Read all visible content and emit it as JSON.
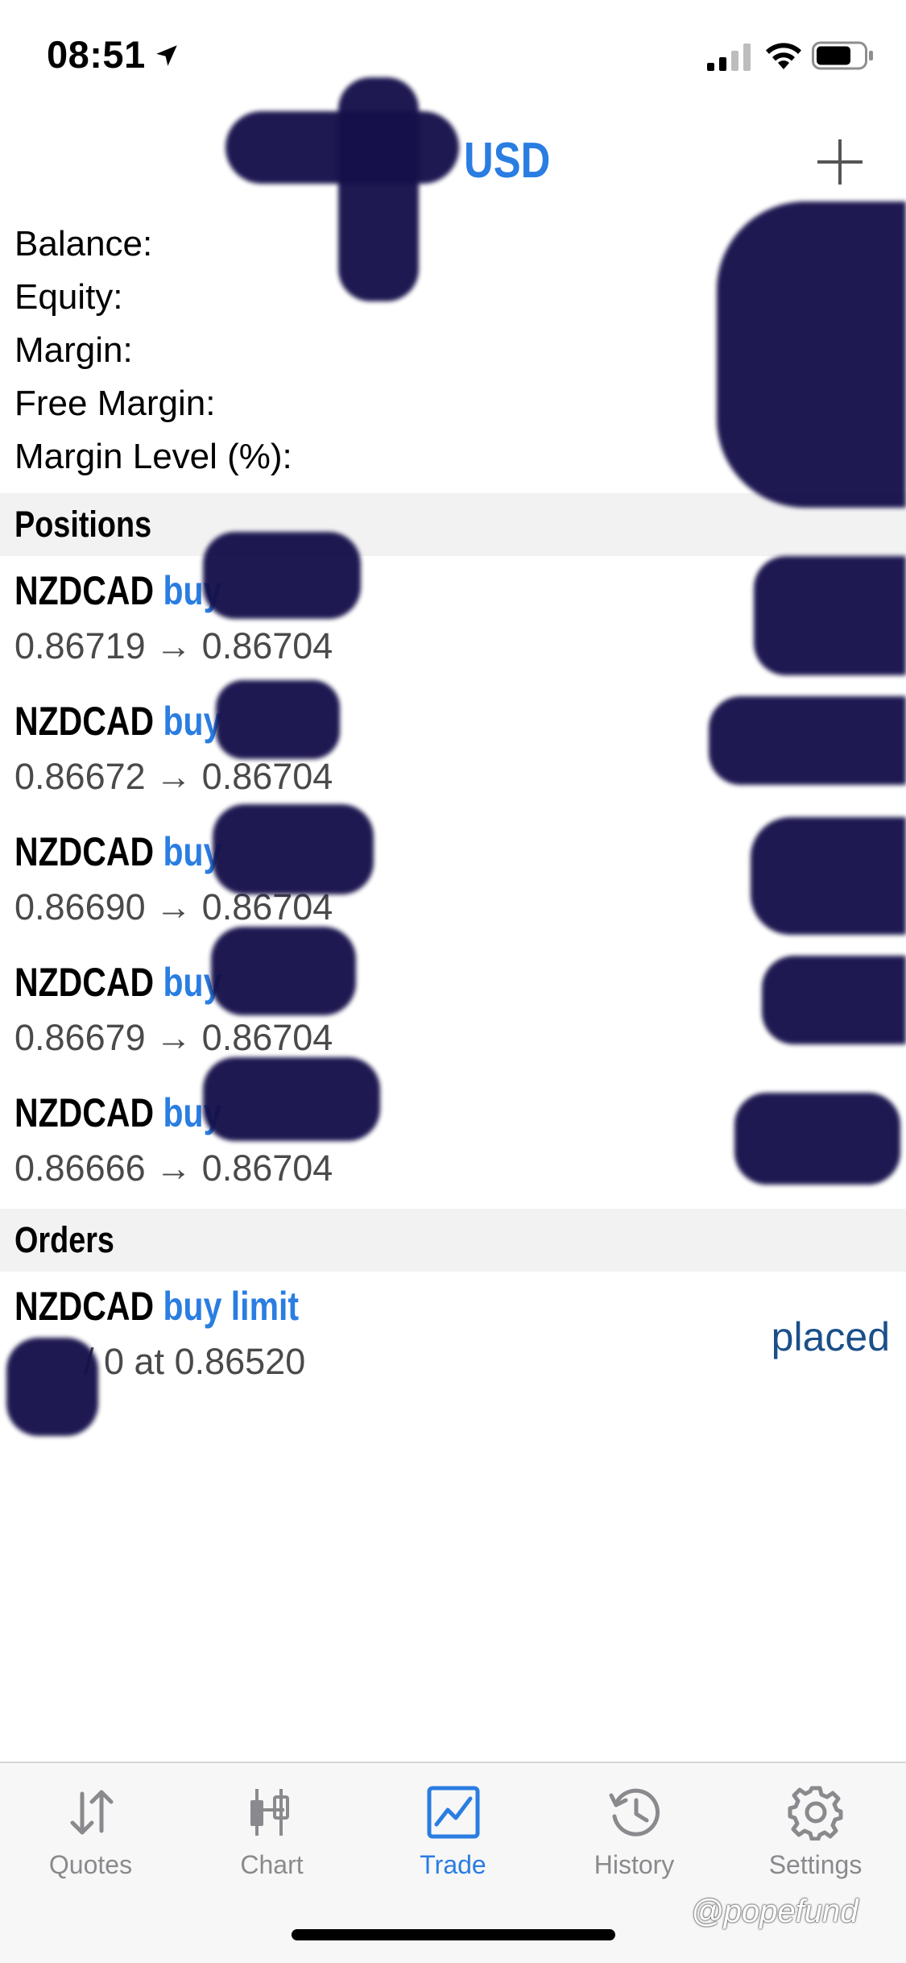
{
  "status_bar": {
    "time": "08:51"
  },
  "header": {
    "account_name": "USD"
  },
  "summary": {
    "labels": [
      "Balance:",
      "Equity:",
      "Margin:",
      "Free Margin:",
      "Margin Level (%):"
    ]
  },
  "sections": {
    "positions": "Positions",
    "orders": "Orders"
  },
  "positions": [
    {
      "symbol": "NZDCAD",
      "side": "buy",
      "prices": "0.86719 → 0.86704"
    },
    {
      "symbol": "NZDCAD",
      "side": "buy",
      "prices": "0.86672 → 0.86704"
    },
    {
      "symbol": "NZDCAD",
      "side": "buy",
      "prices": "0.86690 → 0.86704"
    },
    {
      "symbol": "NZDCAD",
      "side": "buy",
      "prices": "0.86679 → 0.86704"
    },
    {
      "symbol": "NZDCAD",
      "side": "buy",
      "prices": "0.86666 → 0.86704"
    }
  ],
  "orders": [
    {
      "symbol": "NZDCAD",
      "side": "buy limit",
      "details": " / 0 at 0.86520",
      "status": "placed"
    }
  ],
  "tabs": [
    {
      "label": "Quotes",
      "icon": "quotes-icon"
    },
    {
      "label": "Chart",
      "icon": "chart-icon"
    },
    {
      "label": "Trade",
      "icon": "trade-icon",
      "active": true
    },
    {
      "label": "History",
      "icon": "history-icon"
    },
    {
      "label": "Settings",
      "icon": "gear-icon"
    }
  ],
  "watermark": "@popefund",
  "colors": {
    "accent": "#2a7de1",
    "placed": "#1a4f8a",
    "redaction": "#15104a"
  }
}
